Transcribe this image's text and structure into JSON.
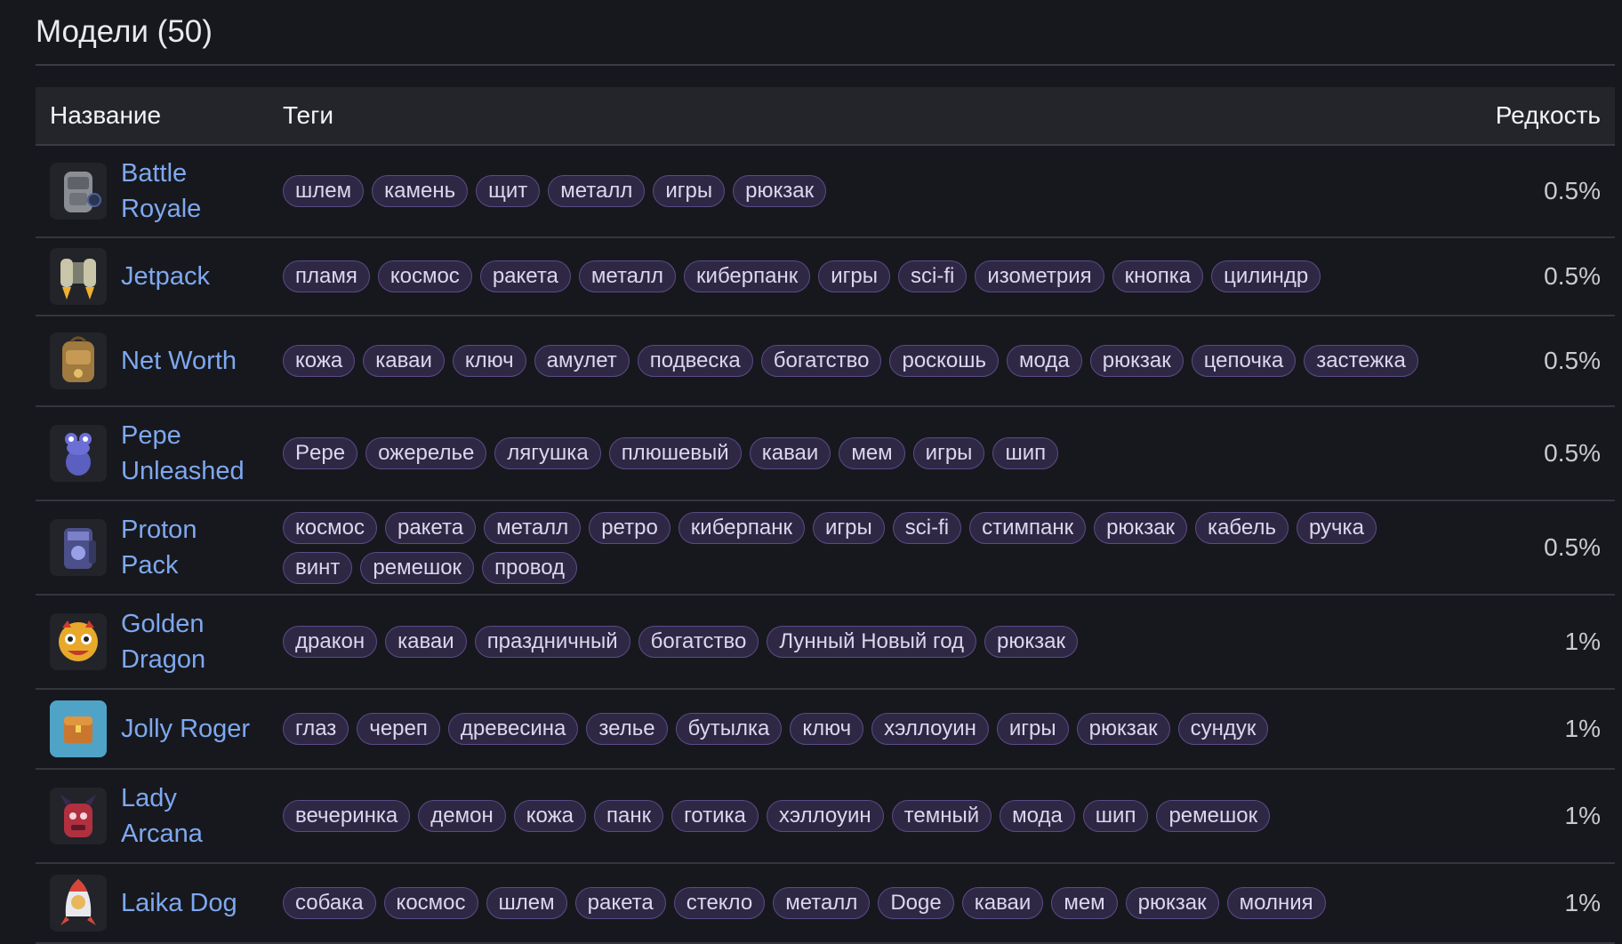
{
  "section_title": "Модели (50)",
  "columns": {
    "name": "Название",
    "tags": "Теги",
    "rarity": "Редкость"
  },
  "rows": [
    {
      "name": "Battle Royale",
      "icon": "backpack-icon",
      "rarity": "0.5%",
      "tags": [
        "шлем",
        "камень",
        "щит",
        "металл",
        "игры",
        "рюкзак"
      ]
    },
    {
      "name": "Jetpack",
      "icon": "jetpack-icon",
      "rarity": "0.5%",
      "tags": [
        "пламя",
        "космос",
        "ракета",
        "металл",
        "киберпанк",
        "игры",
        "sci-fi",
        "изометрия",
        "кнопка",
        "цилиндр"
      ]
    },
    {
      "name": "Net Worth",
      "icon": "money-backpack-icon",
      "rarity": "0.5%",
      "tags": [
        "кожа",
        "каваи",
        "ключ",
        "амулет",
        "подвеска",
        "богатство",
        "роскошь",
        "мода",
        "рюкзак",
        "цепочка",
        "застежка"
      ]
    },
    {
      "name": "Pepe Unleashed",
      "icon": "frog-plush-icon",
      "rarity": "0.5%",
      "tags": [
        "Pepe",
        "ожерелье",
        "лягушка",
        "плюшевый",
        "каваи",
        "мем",
        "игры",
        "шип"
      ]
    },
    {
      "name": "Proton Pack",
      "icon": "proton-pack-icon",
      "rarity": "0.5%",
      "tags": [
        "космос",
        "ракета",
        "металл",
        "ретро",
        "киберпанк",
        "игры",
        "sci-fi",
        "стимпанк",
        "рюкзак",
        "кабель",
        "ручка",
        "винт",
        "ремешок",
        "провод"
      ]
    },
    {
      "name": "Golden Dragon",
      "icon": "dragon-mask-icon",
      "rarity": "1%",
      "tags": [
        "дракон",
        "каваи",
        "праздничный",
        "богатство",
        "Лунный Новый год",
        "рюкзак"
      ]
    },
    {
      "name": "Jolly Roger",
      "icon": "treasure-chest-icon",
      "rarity": "1%",
      "tags": [
        "глаз",
        "череп",
        "древесина",
        "зелье",
        "бутылка",
        "ключ",
        "хэллоуин",
        "игры",
        "рюкзак",
        "сундук"
      ]
    },
    {
      "name": "Lady Arcana",
      "icon": "demon-bag-icon",
      "rarity": "1%",
      "tags": [
        "вечеринка",
        "демон",
        "кожа",
        "панк",
        "готика",
        "хэллоуин",
        "темный",
        "мода",
        "шип",
        "ремешок"
      ]
    },
    {
      "name": "Laika Dog",
      "icon": "rocket-dog-icon",
      "rarity": "1%",
      "tags": [
        "собака",
        "космос",
        "шлем",
        "ракета",
        "стекло",
        "металл",
        "Doge",
        "каваи",
        "мем",
        "рюкзак",
        "молния"
      ]
    }
  ]
}
